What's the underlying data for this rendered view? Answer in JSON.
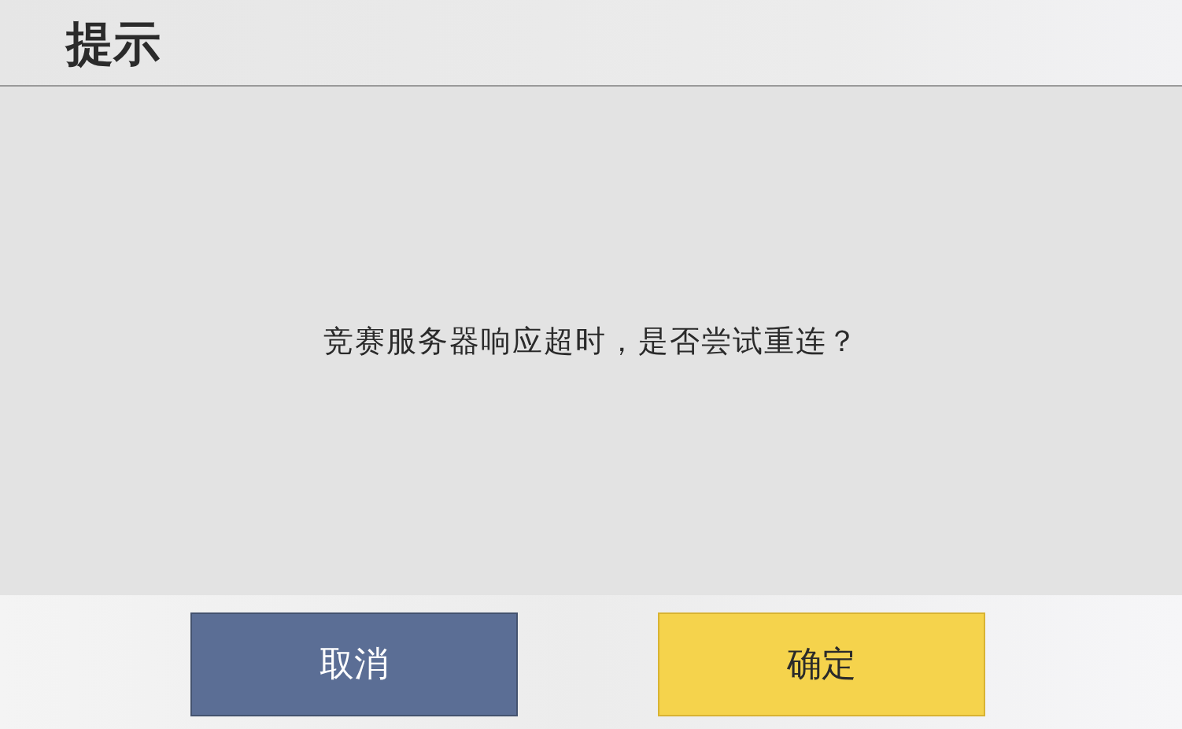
{
  "dialog": {
    "title": "提示",
    "message": "竞赛服务器响应超时，是否尝试重连？",
    "buttons": [
      {
        "label": "取消",
        "kind": "cancel"
      },
      {
        "label": "确定",
        "kind": "confirm"
      }
    ]
  }
}
